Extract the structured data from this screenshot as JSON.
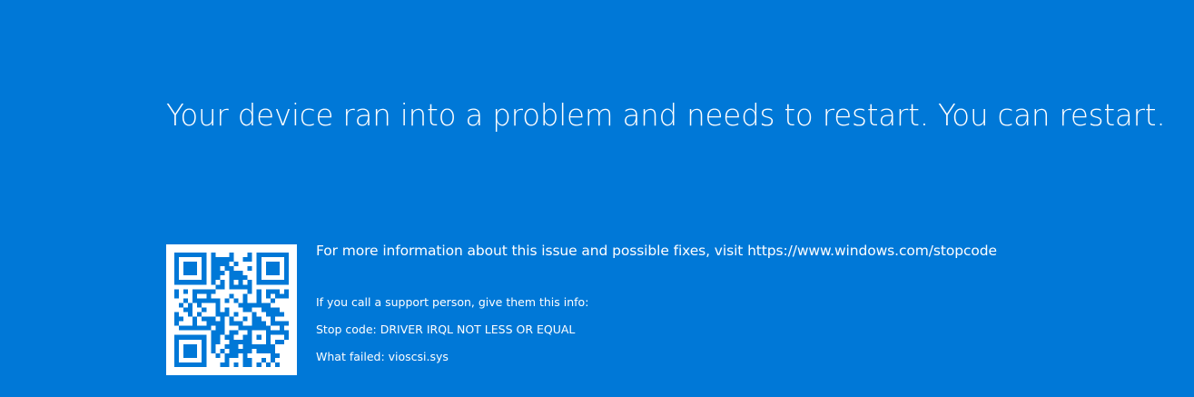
{
  "screen": {
    "background_color": "#0078d7",
    "text_color": "#ffffff",
    "message": "Your device ran into a problem and needs to restart. You can restart.",
    "more_info": "For more information about this issue and possible fixes, visit https://www.windows.com/stopcode",
    "support_hint": "If you call a support person, give them this info:",
    "stop_code_line": "Stop code: DRIVER IRQL NOT LESS OR EQUAL",
    "what_failed_line": "What failed: vioscsi.sys",
    "qr_icon": "qr-code-icon"
  }
}
